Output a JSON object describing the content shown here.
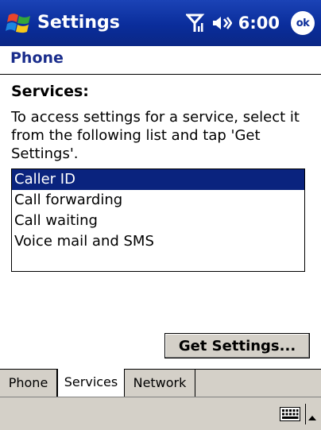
{
  "titlebar": {
    "title": "Settings",
    "time": "6:00",
    "ok_label": "ok",
    "start_icon": "windows-flag-icon",
    "signal_icon": "antenna-icon",
    "volume_icon": "speaker-icon"
  },
  "page": {
    "title": "Phone",
    "section_label": "Services:",
    "instructions": "To access settings for a service, select it from the following list and tap 'Get Settings'."
  },
  "services_list": {
    "items": [
      {
        "label": "Caller ID",
        "selected": true
      },
      {
        "label": "Call forwarding",
        "selected": false
      },
      {
        "label": "Call waiting",
        "selected": false
      },
      {
        "label": "Voice mail and SMS",
        "selected": false
      }
    ]
  },
  "buttons": {
    "get_settings": "Get Settings..."
  },
  "tabs": [
    {
      "label": "Phone",
      "active": false
    },
    {
      "label": "Services",
      "active": true
    },
    {
      "label": "Network",
      "active": false
    }
  ],
  "menubar": {
    "keyboard_icon": "keyboard-icon",
    "sip_arrow_icon": "arrow-up-icon"
  },
  "colors": {
    "titlebar": "#0b2d9a",
    "selection": "#0a237e",
    "page_title": "#1a2d8c",
    "chrome": "#d4d0c8"
  }
}
